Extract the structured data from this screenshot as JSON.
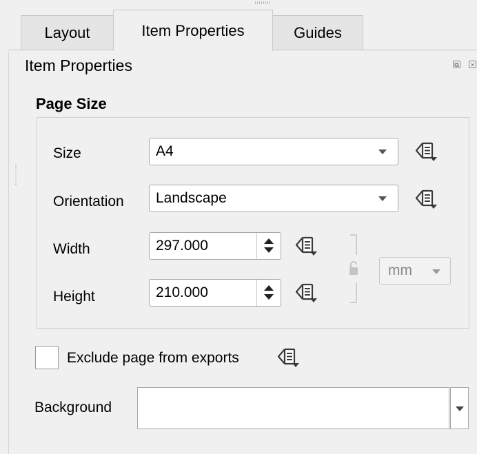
{
  "tabs": [
    {
      "label": "Layout"
    },
    {
      "label": "Item Properties"
    },
    {
      "label": "Guides"
    }
  ],
  "active_tab": "Item Properties",
  "panel": {
    "title": "Item Properties"
  },
  "page_size": {
    "section_title": "Page Size",
    "size": {
      "label": "Size",
      "value": "A4"
    },
    "orientation": {
      "label": "Orientation",
      "value": "Landscape"
    },
    "width": {
      "label": "Width",
      "value": "297.000"
    },
    "height": {
      "label": "Height",
      "value": "210.000"
    },
    "units": {
      "value": "mm"
    }
  },
  "exclude": {
    "label": "Exclude page from exports",
    "checked": false
  },
  "background": {
    "label": "Background",
    "value": ""
  },
  "icons": {
    "data_defined": "data-defined-override-icon",
    "lock": "lock-icon",
    "spin": "spin-arrows-icon"
  },
  "colors": {
    "accent": "#3a3a3a",
    "window_bg": "#f0f0f0"
  }
}
